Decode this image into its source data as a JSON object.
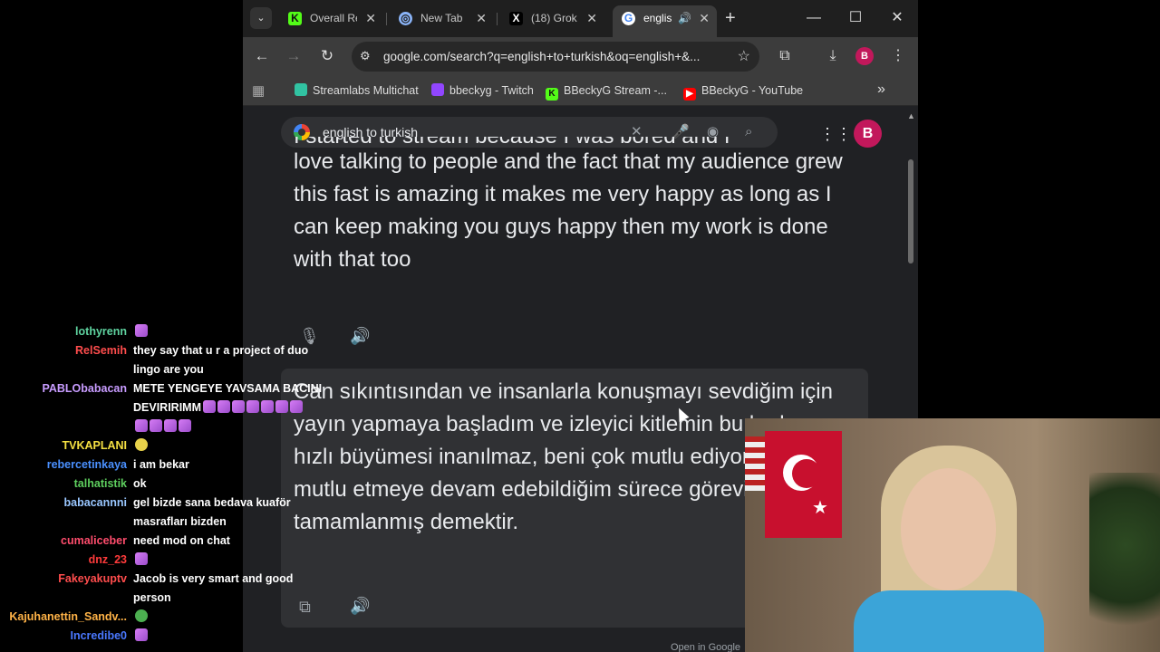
{
  "browser": {
    "tabs": [
      {
        "title": "Overall Re",
        "icon": "kick-icon",
        "active": false
      },
      {
        "title": "New Tab",
        "icon": "chrome-icon",
        "active": false
      },
      {
        "title": "(18) Grok",
        "icon": "x-icon",
        "active": false
      },
      {
        "title": "englis",
        "icon": "google-icon",
        "active": true
      }
    ],
    "url": "google.com/search?q=english+to+turkish&oq=english+&...",
    "profile_initial": "B",
    "bookmarks": [
      {
        "label": "Streamlabs Multichat",
        "icon": "streamlabs-icon",
        "color": "#31c3a2"
      },
      {
        "label": "bbeckyg - Twitch",
        "icon": "twitch-icon",
        "color": "#9146ff"
      },
      {
        "label": "BBeckyG Stream -...",
        "icon": "kick-icon",
        "color": "#53fc18"
      },
      {
        "label": "BBeckyG - YouTube",
        "icon": "youtube-icon",
        "color": "#ff0000"
      }
    ]
  },
  "google": {
    "query": "english to turkish",
    "avatar_initial": "B",
    "source_cut_line": "I started to stream because I was bored and I",
    "source_text": "love talking to people and the fact that my audience grew this fast is amazing it makes me very happy as long as I can keep making you guys happy then my work is done with that too",
    "translation_text": "Can sıkıntısından ve insanlarla konuşmayı sevdiğim için yayın yapmaya başladım ve izleyici kitlemin bu kadar hızlı büyümesi inanılmaz, beni çok mutlu ediyor. Sizleri mutlu etmeye devam edebildiğim sürece görevim tamamlanmış demektir.",
    "open_in_google": "Open in Google"
  },
  "chat": [
    {
      "user": "lothyrenn",
      "color": "#5fd3a0",
      "text": "",
      "emotes": 1,
      "emote_style": ""
    },
    {
      "user": "RelSemih",
      "color": "#ff4d4d",
      "text": "they say that u r a project of duo",
      "emotes": 0,
      "emote_style": ""
    },
    {
      "user": "",
      "color": "#ffffff",
      "text": "lingo are you",
      "emotes": 0,
      "emote_style": ""
    },
    {
      "user": "PABLObabacan",
      "color": "#c89cff",
      "text": "METE YENGEYE YAVSAMA BACINI",
      "emotes": 0,
      "emote_style": ""
    },
    {
      "user": "",
      "color": "#ffffff",
      "text": "DEVIRIRIMM",
      "emotes": 7,
      "emote_style": ""
    },
    {
      "user": "",
      "color": "#ffffff",
      "text": "",
      "emotes": 4,
      "emote_style": ""
    },
    {
      "user": "TVKAPLANI",
      "color": "#f5e042",
      "text": "",
      "emotes": 1,
      "emote_style": "y"
    },
    {
      "user": "rebercetinkaya",
      "color": "#4a90ff",
      "text": "i am bekar",
      "emotes": 0,
      "emote_style": ""
    },
    {
      "user": "talhatistik",
      "color": "#5ecf5e",
      "text": "ok",
      "emotes": 0,
      "emote_style": ""
    },
    {
      "user": "babacannni",
      "color": "#9ac7ff",
      "text": "gel bizde sana bedava kuaför",
      "emotes": 0,
      "emote_style": ""
    },
    {
      "user": "",
      "color": "#ffffff",
      "text": "masrafları bizden",
      "emotes": 0,
      "emote_style": ""
    },
    {
      "user": "cumaliceber",
      "color": "#ff4d6d",
      "text": "need mod on chat",
      "emotes": 0,
      "emote_style": ""
    },
    {
      "user": "dnz_23",
      "color": "#ff3b3b",
      "text": "",
      "emotes": 1,
      "emote_style": ""
    },
    {
      "user": "Fakeyakuptv",
      "color": "#ff4d4d",
      "text": "Jacob is very smart and good",
      "emotes": 0,
      "emote_style": ""
    },
    {
      "user": "",
      "color": "#ffffff",
      "text": "person",
      "emotes": 0,
      "emote_style": ""
    },
    {
      "user": "Kajuhanettin_Sandv...",
      "color": "#ffb347",
      "text": "",
      "emotes": 1,
      "emote_style": "g"
    },
    {
      "user": "Incredibe0",
      "color": "#4a78ff",
      "text": "",
      "emotes": 1,
      "emote_style": ""
    }
  ]
}
